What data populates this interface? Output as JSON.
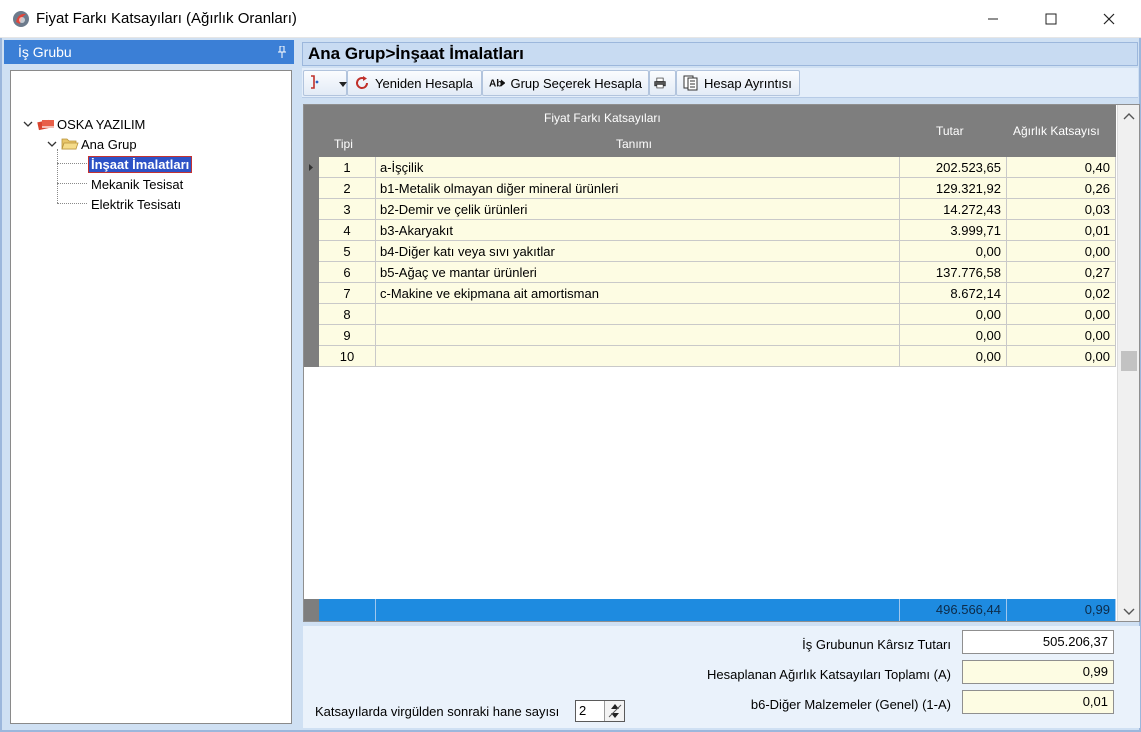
{
  "window": {
    "title": "Fiyat Farkı Katsayıları (Ağırlık Oranları)"
  },
  "left_panel": {
    "header": "İş Grubu",
    "tree": {
      "root": "OSKA YAZILIM",
      "group": "Ana Grup",
      "items": [
        "İnşaat İmalatları",
        "Mekanik Tesisat",
        "Elektrik Tesisatı"
      ],
      "selected": "İnşaat İmalatları"
    }
  },
  "main": {
    "header": "Ana Grup>İnşaat İmalatları",
    "toolbar": {
      "recalc_label": "Yeniden Hesapla",
      "group_calc_label": "Grup Seçerek Hesapla",
      "details_label": "Hesap Ayrıntısı"
    },
    "grid": {
      "group_header": "Fiyat Farkı Katsayıları",
      "columns": {
        "tipi": "Tipi",
        "tanimi": "Tanımı",
        "tutar": "Tutar",
        "agirlik": "Ağırlık Katsayısı"
      },
      "rows": [
        {
          "tipi": "1",
          "tanimi": "a-İşçilik",
          "tutar": "202.523,65",
          "agirlik": "0,40"
        },
        {
          "tipi": "2",
          "tanimi": "b1-Metalik olmayan diğer mineral ürünleri",
          "tutar": "129.321,92",
          "agirlik": "0,26"
        },
        {
          "tipi": "3",
          "tanimi": "b2-Demir ve çelik ürünleri",
          "tutar": "14.272,43",
          "agirlik": "0,03"
        },
        {
          "tipi": "4",
          "tanimi": "b3-Akaryakıt",
          "tutar": "3.999,71",
          "agirlik": "0,01"
        },
        {
          "tipi": "5",
          "tanimi": "b4-Diğer katı veya sıvı yakıtlar",
          "tutar": "0,00",
          "agirlik": "0,00"
        },
        {
          "tipi": "6",
          "tanimi": "b5-Ağaç ve mantar ürünleri",
          "tutar": "137.776,58",
          "agirlik": "0,27"
        },
        {
          "tipi": "7",
          "tanimi": "c-Makine ve ekipmana ait amortisman",
          "tutar": "8.672,14",
          "agirlik": "0,02"
        },
        {
          "tipi": "8",
          "tanimi": "",
          "tutar": "0,00",
          "agirlik": "0,00"
        },
        {
          "tipi": "9",
          "tanimi": "",
          "tutar": "0,00",
          "agirlik": "0,00"
        },
        {
          "tipi": "10",
          "tanimi": "",
          "tutar": "0,00",
          "agirlik": "0,00"
        }
      ],
      "totals": {
        "tutar": "496.566,44",
        "agirlik": "0,99"
      }
    },
    "form": {
      "karsiz_label": "İş Grubunun Kârsız Tutarı",
      "karsiz_value": "505.206,37",
      "toplam_label": "Hesaplanan Ağırlık Katsayıları Toplamı  (A)",
      "toplam_value": "0,99",
      "b6_label": "b6-Diğer Malzemeler (Genel) (1-A)",
      "b6_value": "0,01",
      "decimals_label": "Katsayılarda virgülden sonraki hane sayısı",
      "decimals_value": "2"
    }
  },
  "colors": {
    "accent": "#3b7fd6",
    "selection": "#2d52c6",
    "totals_bar": "#1e8be0",
    "cell_bg": "#fdfce3",
    "header_gray": "#7e7e7e"
  }
}
